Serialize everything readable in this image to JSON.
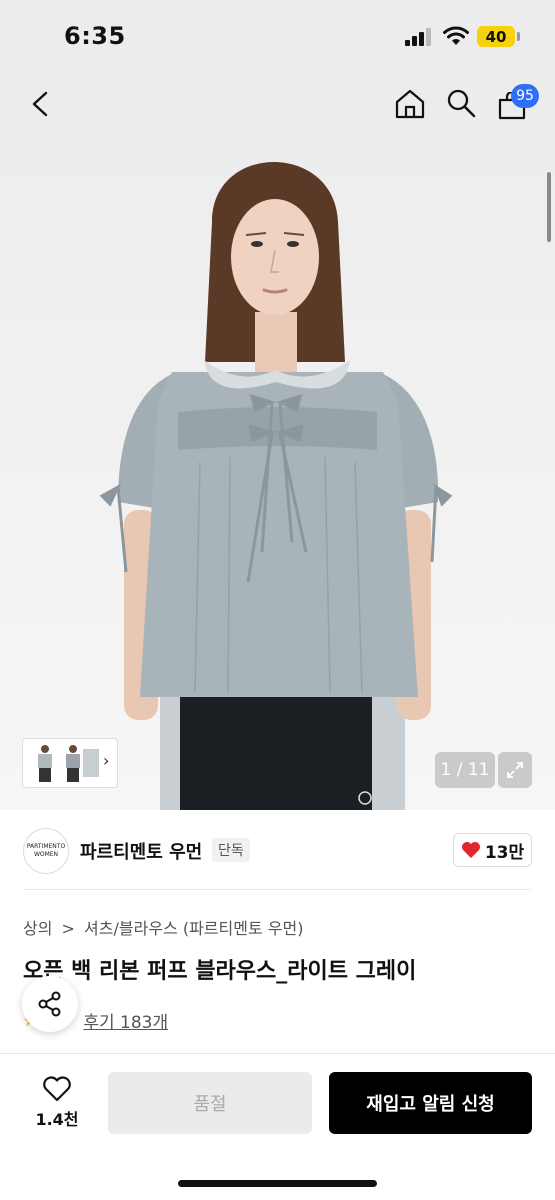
{
  "status_bar": {
    "time": "6:35",
    "battery": "40"
  },
  "header": {
    "cart_count": "95"
  },
  "gallery": {
    "counter": "1 / 11"
  },
  "brand": {
    "logo_line1": "PARTIMENTO",
    "logo_line2": "WOMEN",
    "name": "파르티멘토 우먼",
    "tag": "단독"
  },
  "likes": {
    "count": "13만"
  },
  "breadcrumb": {
    "level1": "상의",
    "separator": ">",
    "level2": "셔츠/블라우스 (파르티멘토 우먼)"
  },
  "product": {
    "title": "오픈 백 리본 퍼프 블라우스_라이트 그레이"
  },
  "reviews": {
    "label": "후기 183개"
  },
  "bottom_bar": {
    "wish_count": "1.4천",
    "soldout_label": "품절",
    "restock_label": "재입고 알림 신청"
  },
  "colors": {
    "accent_blue": "#2f6ff7",
    "heart_red": "#e0262d",
    "battery_yellow": "#f5d20a"
  }
}
